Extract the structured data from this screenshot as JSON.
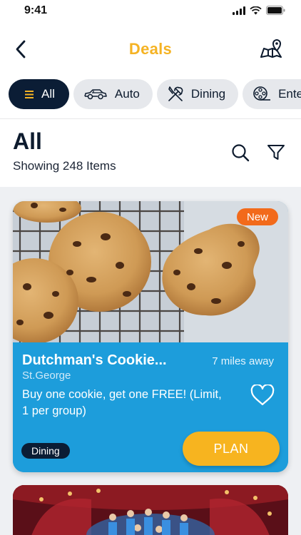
{
  "status_bar": {
    "time": "9:41"
  },
  "nav": {
    "title": "Deals"
  },
  "chips": [
    {
      "label": "All",
      "icon": "list-icon",
      "active": true
    },
    {
      "label": "Auto",
      "icon": "car-icon"
    },
    {
      "label": "Dining",
      "icon": "fork-knife-icon"
    },
    {
      "label": "Entertai",
      "icon": "film-reel-icon"
    }
  ],
  "header": {
    "title": "All",
    "count_text": "Showing 248 Items"
  },
  "deals": [
    {
      "badge": "New",
      "name": "Dutchman's Cookie...",
      "distance": "7 miles away",
      "location": "St.George",
      "description": "Buy one cookie, get one FREE! (Limit, 1 per group)",
      "category": "Dining",
      "cta": "PLAN"
    }
  ],
  "colors": {
    "accent": "#f5b324",
    "navy": "#0b1d35",
    "card_blue": "#1d9ddb",
    "badge_orange": "#f26a1b"
  }
}
